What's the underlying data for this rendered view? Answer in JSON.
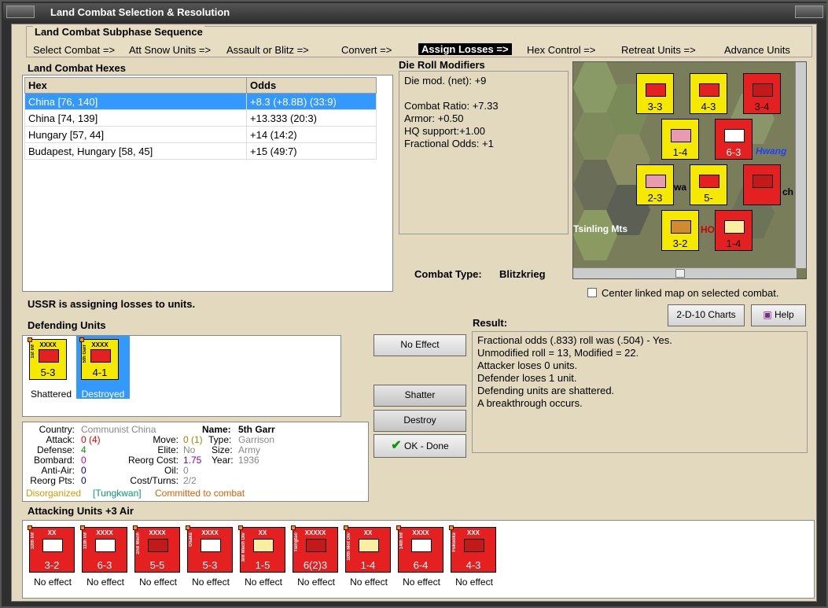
{
  "window": {
    "title": "Land Combat Selection & Resolution"
  },
  "sequence": {
    "heading": "Land Combat Subphase Sequence",
    "steps": [
      "Select Combat =>",
      "Att Snow Units =>",
      "Assault or Blitz =>",
      "Convert =>",
      "Assign Losses =>",
      "Hex Control =>",
      "Retreat Units =>",
      "Advance Units"
    ],
    "active_index": 4
  },
  "hexes": {
    "heading": "Land Combat Hexes",
    "columns": [
      "Hex",
      "Odds"
    ],
    "rows": [
      {
        "hex": "China [76, 140]",
        "odds": "+8.3 (+8.8B) (33:9)",
        "selected": true
      },
      {
        "hex": "China [74, 139]",
        "odds": "+13.333 (20:3)",
        "selected": false
      },
      {
        "hex": "Hungary [57, 44]",
        "odds": "+14 (14:2)",
        "selected": false
      },
      {
        "hex": "Budapest, Hungary [58, 45]",
        "odds": "+15 (49:7)",
        "selected": false
      }
    ]
  },
  "modifiers": {
    "heading": "Die Roll Modifiers",
    "lines": [
      "Die mod. (net): +9",
      "",
      "Combat Ratio: +7.33",
      "Armor: +0.50",
      "HQ support:+1.00",
      "Fractional Odds: +1"
    ]
  },
  "map": {
    "labels": [
      "Tsinling Mts",
      "Hwang",
      "wa",
      "ch",
      "HO"
    ],
    "counters": [
      {
        "str": "3-3",
        "color": "#f5e900"
      },
      {
        "str": "4-3",
        "color": "#f5e900"
      },
      {
        "str": "3-4",
        "color": "#e52020"
      },
      {
        "str": "1-4",
        "color": "#f5e900"
      },
      {
        "str": "6-3",
        "color": "#e52020"
      },
      {
        "str": "2-3",
        "color": "#f5e900"
      },
      {
        "str": "5-",
        "color": "#f5e900"
      },
      {
        "str": "3-2",
        "color": "#f5e900"
      },
      {
        "str": "1-4",
        "color": "#e52020"
      }
    ]
  },
  "combat_type": {
    "label": "Combat Type:",
    "value": "Blitzkrieg"
  },
  "center_map": {
    "label": "Center linked map on selected combat.",
    "checked": false
  },
  "status": "USSR is assigning losses to units.",
  "defending": {
    "heading": "Defending Units",
    "units": [
      {
        "name": "1st Inf",
        "size": "XXXX",
        "str": "5-3",
        "status": "Shattered",
        "color": "#f5e900",
        "selected": false
      },
      {
        "name": "5th Garr",
        "size": "XXXX",
        "str": "4-1",
        "status": "Destroyed",
        "color": "#f5e900",
        "selected": true
      }
    ]
  },
  "buttons": {
    "no_effect": "No Effect",
    "shatter": "Shatter",
    "destroy": "Destroy",
    "ok_done": "OK - Done",
    "charts": "2-D-10 Charts",
    "help": "Help"
  },
  "result": {
    "heading": "Result:",
    "lines": [
      "Fractional odds (.833) roll was (.504)  - Yes.",
      "Unmodified roll = 13, Modified = 22.",
      "Attacker loses 0 units.",
      "Defender loses 1 unit.",
      "Defending units are shattered.",
      "A breakthrough occurs."
    ]
  },
  "unit_info": {
    "country_label": "Country:",
    "country": "Communist China",
    "name_label": "Name:",
    "name": "5th Garr",
    "attack_label": "Attack:",
    "attack": "0",
    "attack_extra": "(4)",
    "move_label": "Move:",
    "move": "0",
    "move_extra": "(1)",
    "type_label": "Type:",
    "type": "Garrison",
    "defense_label": "Defense:",
    "defense": "4",
    "elite_label": "Elite:",
    "elite": "No",
    "size_label": "Size:",
    "size": "Army",
    "bombard_label": "Bombard:",
    "bombard": "0",
    "reorg_label": "Reorg Cost:",
    "reorg": "1.75",
    "year_label": "Year:",
    "year": "1936",
    "antiair_label": "Anti-Air:",
    "antiair": "0",
    "oil_label": "Oil:",
    "oil": "0",
    "reorgpts_label": "Reorg Pts:",
    "reorgpts": "0",
    "costturns_label": "Cost/Turns:",
    "costturns": "2/2",
    "disorganized": "Disorganized",
    "location": "[Tungkwan]",
    "committed": "Committed to combat"
  },
  "attacking": {
    "heading": "Attacking Units +3 Air",
    "units": [
      {
        "name": "10th Inf",
        "size": "XX",
        "str": "3-2",
        "status": "No effect"
      },
      {
        "name": "11th Inf",
        "size": "XXXX",
        "str": "6-3",
        "status": "No effect"
      },
      {
        "name": "2nd Mech",
        "size": "XXXX",
        "str": "5-5",
        "status": "No effect"
      },
      {
        "name": "Osaka",
        "size": "XXXX",
        "str": "5-3",
        "status": "No effect"
      },
      {
        "name": "3rd Mech Div",
        "size": "XX",
        "str": "1-5",
        "status": "No effect"
      },
      {
        "name": "Tsingtao",
        "size": "XXXXX",
        "str": "6(2)3",
        "status": "No effect"
      },
      {
        "name": "10th Mot Div",
        "size": "XX",
        "str": "1-4",
        "status": "No effect"
      },
      {
        "name": "14th Inf",
        "size": "XXXX",
        "str": "6-4",
        "status": "No effect"
      },
      {
        "name": "Fukuoka",
        "size": "XXX",
        "str": "4-3",
        "status": "No effect"
      }
    ]
  },
  "colors": {
    "accent": "#3399ff",
    "counter_red": "#e52020",
    "counter_yellow": "#f5e900",
    "panel": "#e3d9bf"
  }
}
